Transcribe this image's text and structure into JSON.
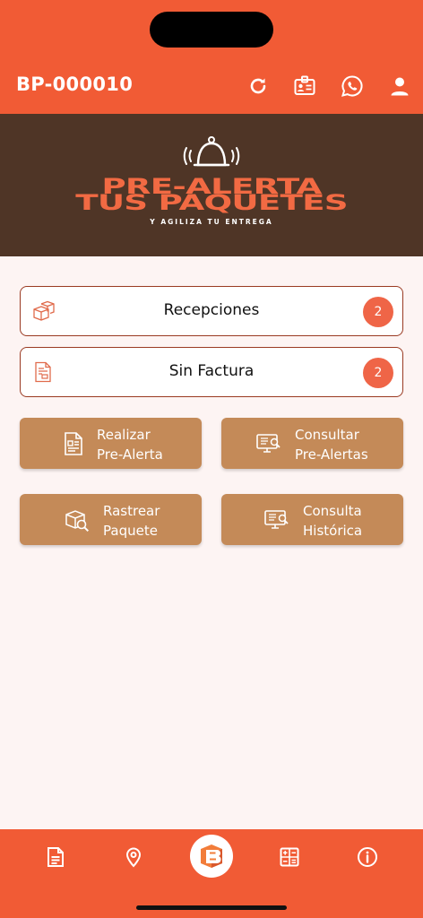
{
  "header": {
    "account_id": "BP-000010"
  },
  "banner": {
    "line1": "PRE-ALERTA",
    "line2": "TUS PAQUETES",
    "subtitle": "Y AGILIZA TU ENTREGA"
  },
  "cards": [
    {
      "label": "Recepciones",
      "count": "2"
    },
    {
      "label": "Sin Factura",
      "count": "2"
    }
  ],
  "tiles": [
    {
      "line1": "Realizar",
      "line2": "Pre-Alerta"
    },
    {
      "line1": "Consultar",
      "line2": "Pre-Alertas"
    },
    {
      "line1": "Rastrear",
      "line2": "Paquete"
    },
    {
      "line1": "Consulta",
      "line2": "Histórica"
    }
  ],
  "icons": {
    "header": [
      "refresh-icon",
      "id-card-icon",
      "whatsapp-icon",
      "user-icon"
    ],
    "nav": [
      "document-icon",
      "location-pin-icon",
      "home-logo-icon",
      "calculator-icon",
      "info-icon"
    ]
  },
  "colors": {
    "primary": "#f15b35",
    "banner_bg": "#4f3526",
    "tile": "#c48a58",
    "badge": "#ef6547",
    "background": "#fdf4f3"
  }
}
